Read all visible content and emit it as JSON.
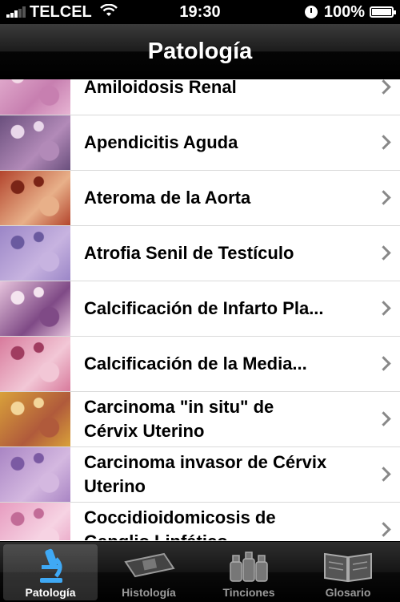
{
  "status_bar": {
    "carrier": "TELCEL",
    "time": "19:30",
    "battery": "100%"
  },
  "nav": {
    "title": "Patología"
  },
  "list": {
    "items": [
      {
        "label": "Amiloidosis Renal",
        "thumb_colors": [
          "#e7b4d3",
          "#c77fb0",
          "#f3dbe8"
        ]
      },
      {
        "label": "Apendicitis Aguda",
        "thumb_colors": [
          "#6a4f7d",
          "#b28ab8",
          "#e9d7ea"
        ]
      },
      {
        "label": "Ateroma de la Aorta",
        "thumb_colors": [
          "#b3452d",
          "#e8b089",
          "#7a2416"
        ]
      },
      {
        "label": "Atrofia Senil de Testículo",
        "thumb_colors": [
          "#9b86c7",
          "#c7b3e0",
          "#6a5a9f"
        ]
      },
      {
        "label": "Calcificación de Infarto Pla...",
        "thumb_colors": [
          "#e6c3dc",
          "#7f4a86",
          "#f4e4ef"
        ]
      },
      {
        "label": "Calcificación de la Media...",
        "thumb_colors": [
          "#d87a9c",
          "#f2c7d6",
          "#a03c60"
        ]
      },
      {
        "label": "Carcinoma \"in situ\" de\nCérvix Uterino",
        "thumb_colors": [
          "#d9a13a",
          "#b05a3b",
          "#f3d69a"
        ]
      },
      {
        "label": "Carcinoma invasor de Cérvix\nUterino",
        "thumb_colors": [
          "#a985c4",
          "#d4b8e0",
          "#7b5aa3"
        ]
      },
      {
        "label": "Coccidioidomicosis de\nGanglio Linfático",
        "thumb_colors": [
          "#e79cc0",
          "#f6d3e3",
          "#c26b97"
        ]
      }
    ]
  },
  "tabs": [
    {
      "label": "Patología",
      "icon": "microscope-icon",
      "selected": true
    },
    {
      "label": "Histología",
      "icon": "glass-slide-icon",
      "selected": false
    },
    {
      "label": "Tinciones",
      "icon": "stain-bottles-icon",
      "selected": false
    },
    {
      "label": "Glosario",
      "icon": "open-book-icon",
      "selected": false
    }
  ],
  "colors": {
    "accent_selected_tab": "#3fa9f5",
    "chevron": "#888888"
  }
}
